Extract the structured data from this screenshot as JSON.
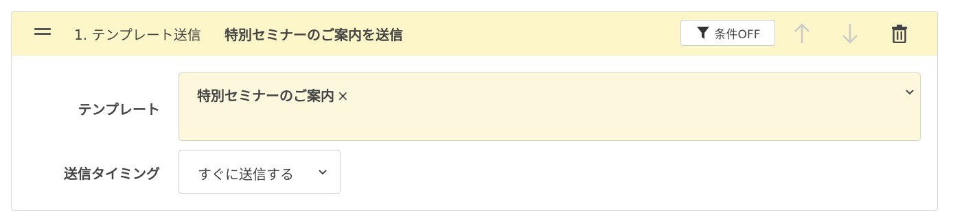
{
  "step": {
    "number_label": "1. テンプレート送信",
    "title": "特別セミナーのご案内を送信",
    "condition_button_label": "条件OFF"
  },
  "icons": {
    "drag": "drag-handle-icon",
    "filter": "filter-icon",
    "move_up": "arrow-up-icon",
    "move_down": "arrow-down-icon",
    "delete": "trash-icon"
  },
  "fields": {
    "template": {
      "label": "テンプレート",
      "selected_tag": "特別セミナーのご案内",
      "remove_glyph": "×"
    },
    "timing": {
      "label": "送信タイミング",
      "value": "すぐに送信する"
    }
  },
  "colors": {
    "header_bg": "#fcf6c8",
    "select_bg": "#fdf8dd",
    "text": "#444444",
    "disabled_icon": "#c9c9c9"
  }
}
